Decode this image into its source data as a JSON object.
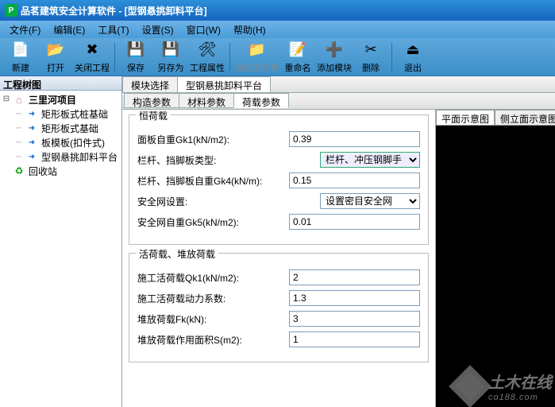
{
  "title": "品茗建筑安全计算软件 - [型钢悬挑卸料平台]",
  "menus": [
    "文件(F)",
    "编辑(E)",
    "工具(T)",
    "设置(S)",
    "窗口(W)",
    "帮助(H)"
  ],
  "toolbar": [
    {
      "label": "新建",
      "icon": "📄"
    },
    {
      "label": "打开",
      "icon": "📂"
    },
    {
      "label": "关闭工程",
      "icon": "✖"
    },
    {
      "label": "保存",
      "icon": "💾"
    },
    {
      "label": "另存为",
      "icon": "💾"
    },
    {
      "label": "工程属性",
      "icon": "🛠"
    },
    {
      "label": "添加文件夹",
      "icon": "📁",
      "disabled": true
    },
    {
      "label": "重命名",
      "icon": "📝"
    },
    {
      "label": "添加模块",
      "icon": "➕"
    },
    {
      "label": "删除",
      "icon": "✂"
    },
    {
      "label": "退出",
      "icon": "⏏"
    }
  ],
  "tree_header": "工程树图",
  "tree": {
    "root": "三里河项目",
    "children": [
      "矩形板式桩基础",
      "矩形板式基础",
      "板模板(扣件式)",
      "型钢悬挑卸料平台"
    ],
    "recycle": "回收站"
  },
  "module_tabs": [
    "模块选择",
    "型钢悬挑卸料平台"
  ],
  "param_tabs": [
    "构造参数",
    "材料参数",
    "荷载参数"
  ],
  "groups": {
    "g1": {
      "title": "恒荷载",
      "rows": [
        {
          "label": "面板自重Gk1(kN/m2):",
          "value": "0.39",
          "type": "input"
        },
        {
          "label": "栏杆、挡脚板类型:",
          "value": "栏杆、冲压钢脚手",
          "type": "select_hl"
        },
        {
          "label": "栏杆、挡脚板自重Gk4(kN/m):",
          "value": "0.15",
          "type": "input"
        },
        {
          "label": "安全网设置:",
          "value": "设置密目安全网",
          "type": "select"
        },
        {
          "label": "安全网自重Gk5(kN/m2):",
          "value": "0.01",
          "type": "input"
        }
      ]
    },
    "g2": {
      "title": "活荷载、堆放荷载",
      "rows": [
        {
          "label": "施工活荷载Qk1(kN/m2):",
          "value": "2",
          "type": "input"
        },
        {
          "label": "施工活荷载动力系数:",
          "value": "1.3",
          "type": "input"
        },
        {
          "label": "堆放荷载Fk(kN):",
          "value": "3",
          "type": "input"
        },
        {
          "label": "堆放荷载作用面积S(m2):",
          "value": "1",
          "type": "input"
        }
      ]
    }
  },
  "preview_tabs": [
    "平面示意图",
    "侧立面示意图"
  ],
  "watermark": {
    "main": "土木在线",
    "sub": "co188.com"
  }
}
